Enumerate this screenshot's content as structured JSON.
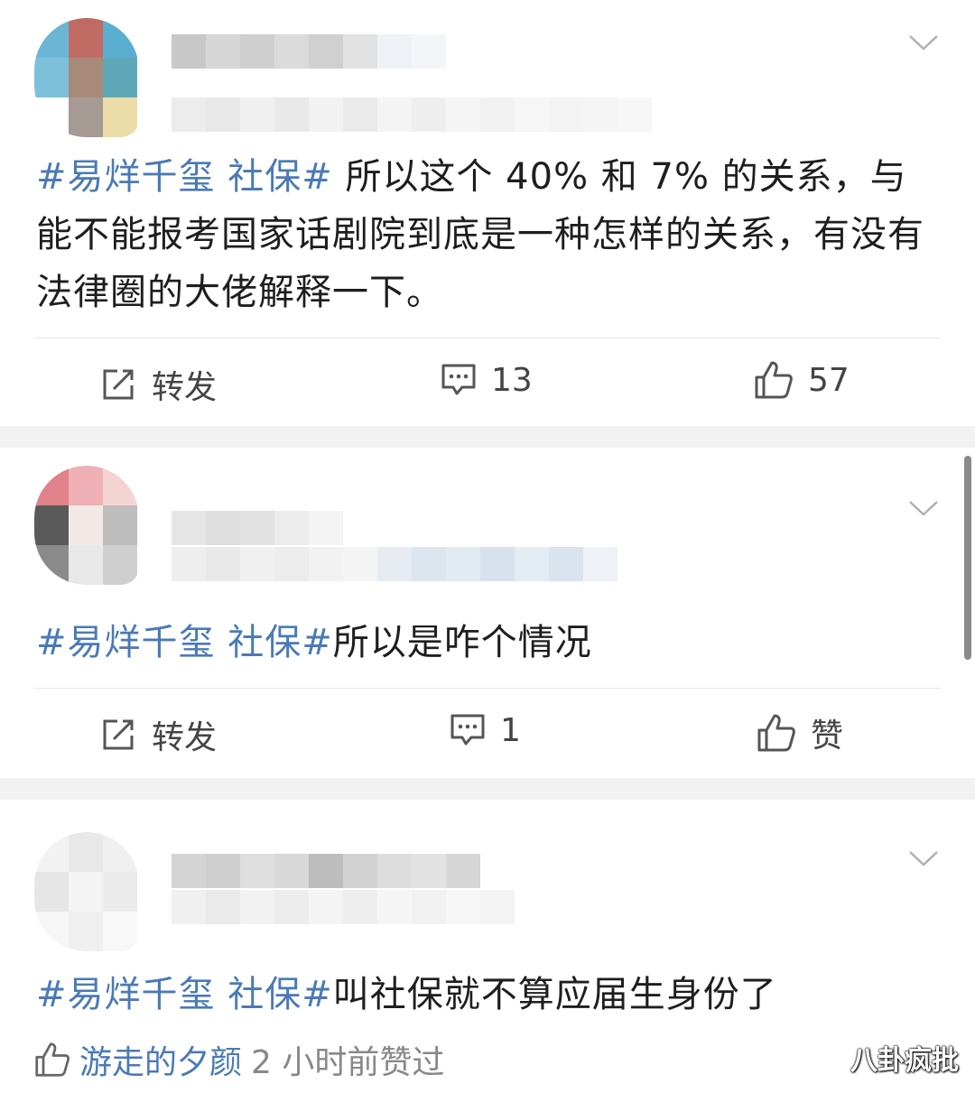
{
  "posts": [
    {
      "hashtag": "#易烊千玺 社保#",
      "text": " 所以这个 40% 和 7% 的关系，与能不能报考国家话剧院到底是一种怎样的关系，有没有法律圈的大佬解释一下。",
      "actions": {
        "repost_label": "转发",
        "comment_count": "13",
        "like_count": "57"
      }
    },
    {
      "hashtag": "#易烊千玺 社保#",
      "text": "所以是咋个情况",
      "actions": {
        "repost_label": "转发",
        "comment_count": "1",
        "like_label": "赞"
      }
    },
    {
      "hashtag": "#易烊千玺 社保#",
      "text": "叫社保就不算应届生身份了",
      "liked_by": {
        "user": "游走的夕颜",
        "text": "2 小时前赞过"
      }
    }
  ],
  "watermark": "八卦疯批",
  "icons": [
    "chevron-down-icon",
    "repost-icon",
    "comment-icon",
    "thumbs-up-icon"
  ],
  "colors": {
    "hashtag": "#4a7ab5",
    "separator": "#f2f2f2",
    "text": "#1e1e1e"
  }
}
